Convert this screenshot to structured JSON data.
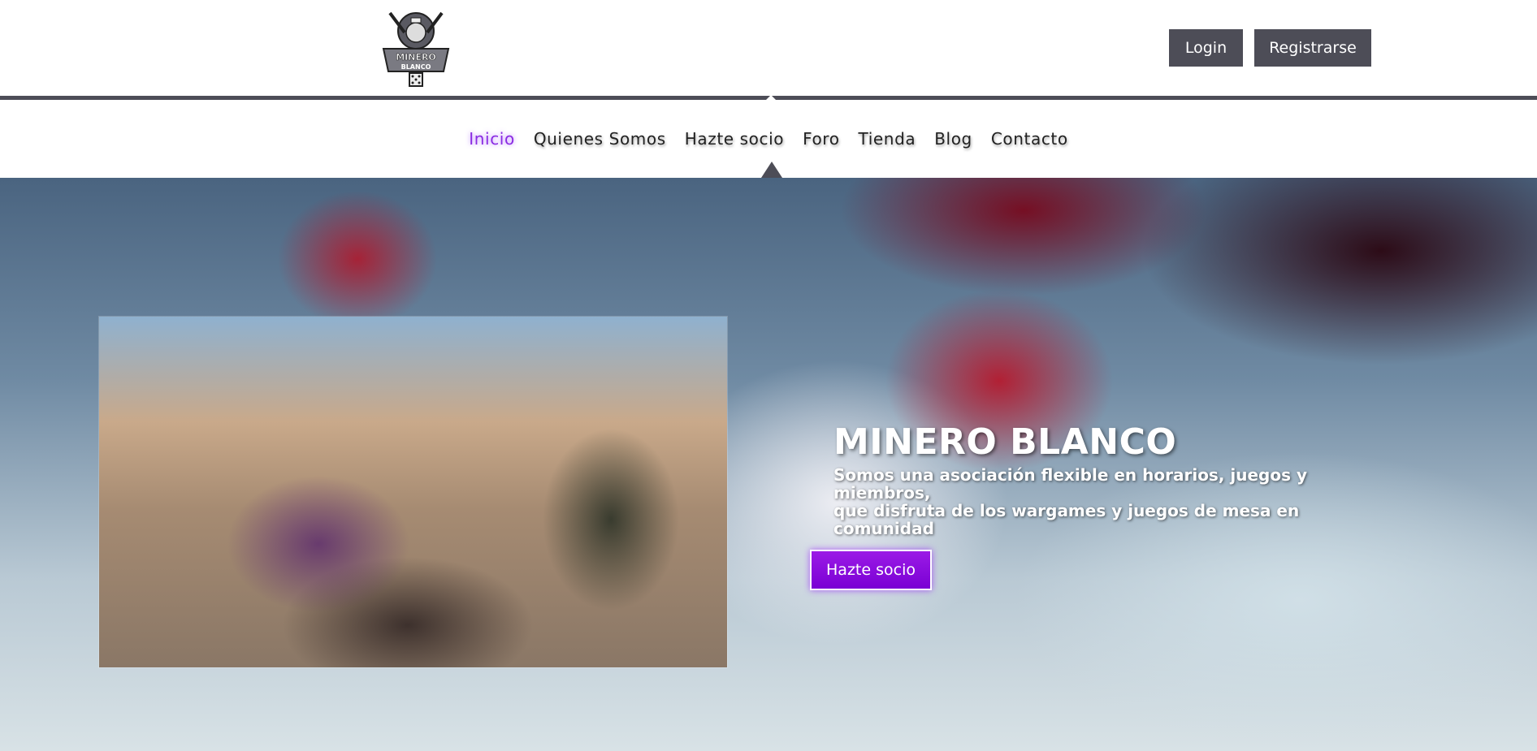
{
  "header": {
    "logo_text_top": "MINERO",
    "logo_text_bottom": "BLANCO",
    "login_label": "Login",
    "register_label": "Registrarse"
  },
  "nav": {
    "items": [
      {
        "label": "Inicio",
        "active": true
      },
      {
        "label": "Quienes Somos"
      },
      {
        "label": "Hazte socio"
      },
      {
        "label": "Foro"
      },
      {
        "label": "Tienda"
      },
      {
        "label": "Blog"
      },
      {
        "label": "Contacto"
      }
    ]
  },
  "hero": {
    "title": "MINERO BLANCO",
    "subtitle_line1": "Somos una asociación flexible en horarios, juegos y miembros,",
    "subtitle_line2": "que disfruta de los wargames y juegos de mesa en comunidad",
    "cta_label": "Hazte socio"
  },
  "colors": {
    "accent": "#8a2be2",
    "button_dark": "#4d4d57"
  }
}
